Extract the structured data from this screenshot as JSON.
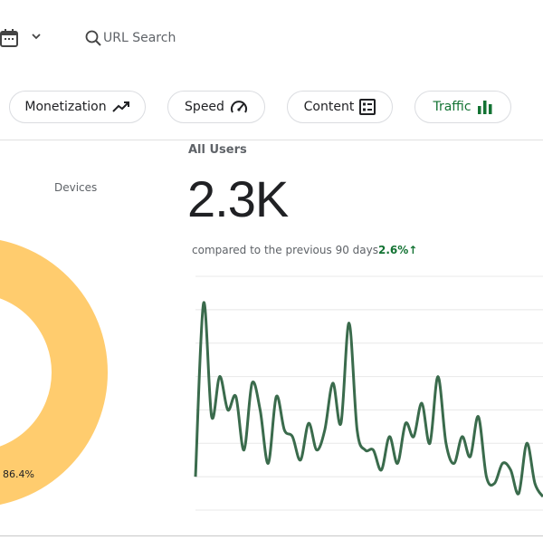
{
  "toolbar": {
    "calendar_icon": "calendar-icon",
    "chevron_icon": "chevron-down-icon",
    "search_icon": "search-icon",
    "url_search_label": "URL Search"
  },
  "chips": [
    {
      "label": "Monetization",
      "icon": "trending-up-icon",
      "active": false
    },
    {
      "label": "Speed",
      "icon": "speedometer-icon",
      "active": false
    },
    {
      "label": "Content",
      "icon": "article-icon",
      "active": false
    },
    {
      "label": "Traffic",
      "icon": "bar-chart-icon",
      "active": true
    }
  ],
  "devices": {
    "title": "Devices",
    "slice_label": "86.4%",
    "colors": {
      "main": "#FFCC6E"
    }
  },
  "metric": {
    "title": "All Users",
    "value": "2.3K",
    "compare_text": "compared to the previous 90 days",
    "change": "2.6%",
    "change_icon": "arrow-up-icon",
    "line_color": "#3A6B4C"
  },
  "chart_data": [
    {
      "type": "pie",
      "title": "Devices",
      "values": [
        86.4
      ],
      "labels": [
        "86.4%"
      ],
      "colors": [
        "#FFCC6E"
      ]
    },
    {
      "type": "line",
      "series": [
        {
          "values": [
            10,
            62,
            28,
            40,
            30,
            34,
            18,
            38,
            30,
            14,
            34,
            24,
            22,
            15,
            26,
            18,
            24,
            38,
            26,
            56,
            24,
            18,
            18,
            12,
            22,
            14,
            26,
            22,
            32,
            20,
            40,
            20,
            14,
            22,
            16,
            28,
            10,
            8,
            14,
            12,
            5,
            20,
            8,
            4
          ]
        }
      ],
      "ylim": [
        0,
        70
      ],
      "grid": true
    }
  ]
}
